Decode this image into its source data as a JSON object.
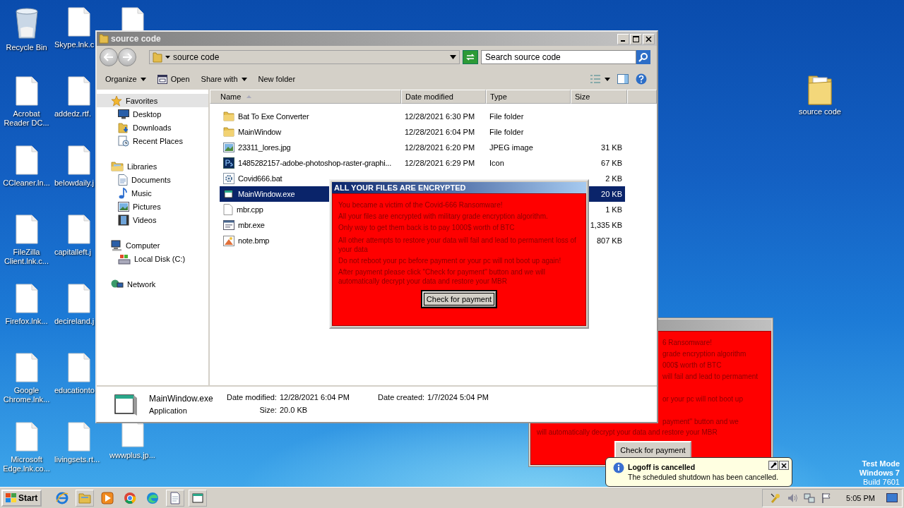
{
  "desktop": {
    "columns": [
      [
        {
          "kind": "recycle",
          "label": "Recycle Bin"
        },
        {
          "kind": "doc",
          "label": "Acrobat Reader DC..."
        },
        {
          "kind": "doc",
          "label": "CCleaner.ln..."
        },
        {
          "kind": "doc",
          "label": "FileZilla Client.lnk.c..."
        },
        {
          "kind": "doc",
          "label": "Firefox.lnk..."
        },
        {
          "kind": "doc",
          "label": "Google Chrome.lnk..."
        },
        {
          "kind": "doc",
          "label": "Microsoft Edge.lnk.co..."
        }
      ],
      [
        {
          "kind": "doc",
          "label": "Skype.lnk.c"
        },
        {
          "kind": "doc",
          "label": "addedz.rtf."
        },
        {
          "kind": "doc",
          "label": "belowdaily.j"
        },
        {
          "kind": "doc",
          "label": "capitalleft.j"
        },
        {
          "kind": "doc",
          "label": "decireland.j"
        },
        {
          "kind": "doc",
          "label": "educationto"
        },
        {
          "kind": "doc",
          "label": "livingsets.rt..."
        }
      ],
      [
        {
          "kind": "doc"
        },
        {
          "kind": "doc",
          "label": "wwwplus.jp..."
        }
      ]
    ],
    "right_icon": {
      "kind": "folder",
      "label": "source code"
    },
    "test_mode": [
      "Test Mode",
      "Windows 7",
      "Build 7601"
    ]
  },
  "explorer": {
    "title": "source code",
    "address": "source code",
    "search": {
      "placeholder": "Search source code"
    },
    "toolbar": [
      {
        "label": "Organize",
        "kind": "menu"
      },
      {
        "label": "Open",
        "kind": "open"
      },
      {
        "label": "Share with",
        "kind": "menu"
      },
      {
        "label": "New folder",
        "kind": "plain"
      }
    ],
    "nav": [
      {
        "label": "Favorites",
        "kind": "star",
        "selected": true,
        "children": [
          {
            "label": "Desktop",
            "kind": "desktop"
          },
          {
            "label": "Downloads",
            "kind": "downloads"
          },
          {
            "label": "Recent Places",
            "kind": "recent"
          }
        ]
      },
      {
        "label": "Libraries",
        "kind": "libraries",
        "selected": false,
        "children": [
          {
            "label": "Documents",
            "kind": "documents"
          },
          {
            "label": "Music",
            "kind": "music"
          },
          {
            "label": "Pictures",
            "kind": "pictures"
          },
          {
            "label": "Videos",
            "kind": "videos"
          }
        ]
      },
      {
        "label": "Computer",
        "kind": "computer",
        "selected": false,
        "children": [
          {
            "label": "Local Disk (C:)",
            "kind": "disk"
          }
        ]
      },
      {
        "label": "Network",
        "kind": "network",
        "selected": false
      }
    ],
    "columns": [
      "Name",
      "Date modified",
      "Type",
      "Size"
    ],
    "rows": [
      {
        "kind": "folder",
        "name": "Bat To Exe Converter",
        "date": "12/28/2021 6:30 PM",
        "type": "File folder",
        "selected": false
      },
      {
        "kind": "folder",
        "name": "MainWindow",
        "date": "12/28/2021 6:04 PM",
        "type": "File folder",
        "selected": false
      },
      {
        "kind": "image",
        "name": "23311_lores.jpg",
        "date": "12/28/2021 6:20 PM",
        "type": "JPEG image",
        "size": "31 KB",
        "selected": false
      },
      {
        "kind": "ps",
        "name": "1485282157-adobe-photoshop-raster-graphi...",
        "date": "12/28/2021 6:29 PM",
        "type": "Icon",
        "size": "67 KB",
        "selected": false
      },
      {
        "kind": "bat",
        "name": "Covid666.bat",
        "size": "2 KB",
        "selected": false
      },
      {
        "kind": "app",
        "name": "MainWindow.exe",
        "size": "20 KB",
        "selected": true
      },
      {
        "kind": "text",
        "name": "mbr.cpp",
        "size": "1 KB",
        "selected": false
      },
      {
        "kind": "exe",
        "name": "mbr.exe",
        "size": "1,335 KB",
        "selected": false
      },
      {
        "kind": "bmp",
        "name": "note.bmp",
        "size": "807 KB",
        "selected": false
      }
    ],
    "details": {
      "name": "MainWindow.exe",
      "type": "Application",
      "fields": [
        {
          "label": "Date modified:",
          "value": "12/28/2021 6:04 PM"
        },
        {
          "label": "Date created:",
          "value": "1/7/2024 5:04 PM"
        },
        {
          "label": "Size:",
          "value": "20.0 KB"
        }
      ]
    }
  },
  "ransom_dialog": {
    "title": "ALL YOUR FILES ARE ENCRYPTED",
    "lines": [
      "You became a victim of the Covid-666 Ransomware!",
      "All your files are encrypted with military grade encryption algorithm.",
      "Only way to get them back is to pay 1000$ worth of BTC",
      "All other attempts to restore your data will fail and lead to permament loss of your data",
      "Do not reboot your pc before payment or your pc will not boot up again!",
      "After payment please click \"Check for payment'' button and we will automatically decrypt your data and restore your MBR"
    ],
    "button": "Check for payment"
  },
  "ransom_dialog_behind": {
    "fragments": [
      [
        "6 Ransomware!",
        "grade encryption algorithm",
        "000$ worth of BTC",
        "will fail and lead to permament"
      ],
      [
        "or your pc will not boot up"
      ],
      [
        "payment'' button and we"
      ]
    ],
    "last_line": "will automatically decrypt your data and restore your MBR",
    "button": "Check for payment"
  },
  "notification": {
    "title": "Logoff is cancelled",
    "text": "The scheduled shutdown has been cancelled."
  },
  "taskbar": {
    "start": "Start",
    "apps": [
      {
        "kind": "ie"
      },
      {
        "kind": "explorer"
      },
      {
        "kind": "media"
      },
      {
        "kind": "chrome"
      },
      {
        "kind": "edge"
      },
      {
        "kind": "notepad"
      },
      {
        "kind": "window"
      }
    ],
    "tray": [
      {
        "kind": "wrench"
      },
      {
        "kind": "speaker"
      },
      {
        "kind": "network"
      },
      {
        "kind": "flag"
      }
    ],
    "clock": "5:05 PM"
  }
}
